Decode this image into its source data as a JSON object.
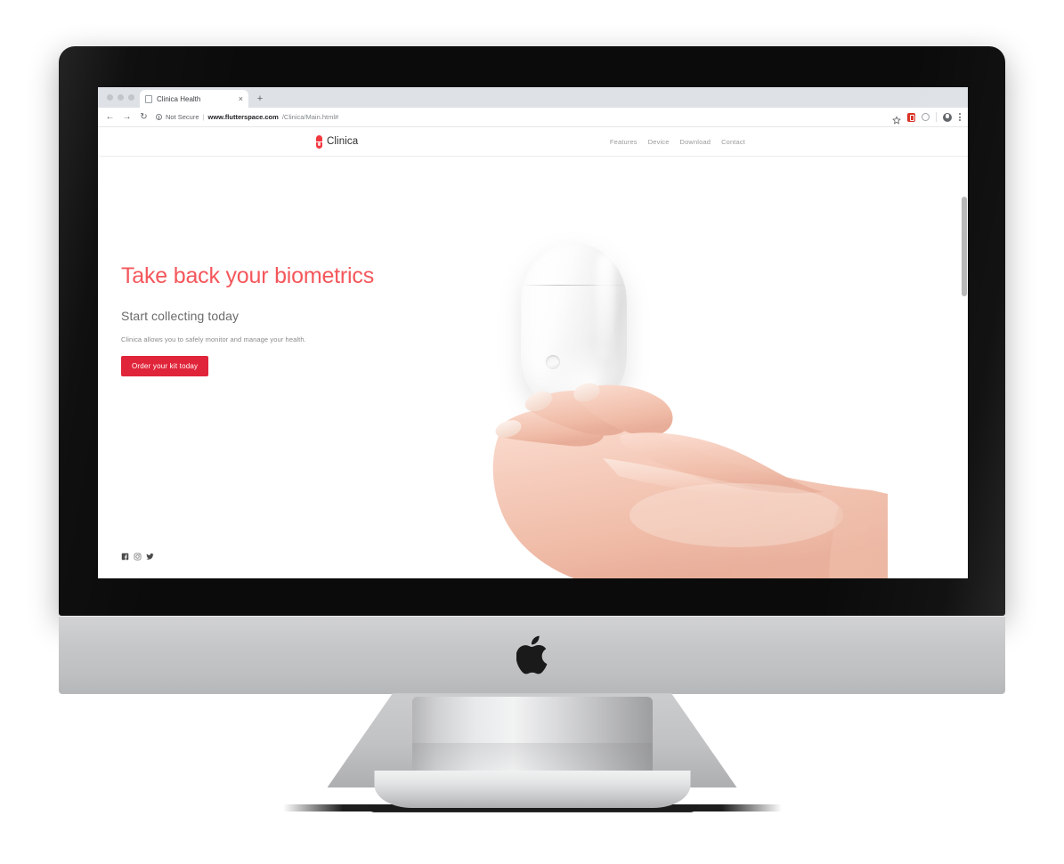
{
  "browser": {
    "traffic_lights": [
      "close",
      "minimize",
      "maximize"
    ],
    "tab": {
      "title": "Clinica Health",
      "close_label": "×",
      "favicon": "page-icon"
    },
    "new_tab_label": "+",
    "nav": {
      "back": "←",
      "forward": "→",
      "reload": "↻"
    },
    "omnibox": {
      "security_label": "Not Secure",
      "separator": "|",
      "url_domain": "www.flutterspace.com",
      "url_path": "/Clinica/Main.html#",
      "full_url": "www.flutterspace.com/Clinica/Main.html#"
    },
    "toolbar_icons": [
      {
        "name": "bookmark-star-icon",
        "glyph": "☆"
      },
      {
        "name": "extension-badge-icon",
        "color": "#d93025"
      },
      {
        "name": "extension-circle-icon"
      },
      {
        "name": "profile-avatar-icon"
      },
      {
        "name": "chrome-menu-icon"
      }
    ]
  },
  "site": {
    "brand": {
      "logo_icon": "pill-capsule-icon",
      "name": "Clinica"
    },
    "nav_items": [
      {
        "label": "Features"
      },
      {
        "label": "Device"
      },
      {
        "label": "Download"
      },
      {
        "label": "Contact"
      }
    ],
    "hero": {
      "headline": "Take back your biometrics",
      "subhead": "Start collecting today",
      "blurb": "Clinica allows you to safely monitor and manage your health.",
      "cta_label": "Order your kit today",
      "art_description": "white pill-shaped biometric device floating above an open palm"
    },
    "social": [
      {
        "name": "facebook-icon",
        "glyph": "f"
      },
      {
        "name": "instagram-icon",
        "glyph": "◎"
      },
      {
        "name": "twitter-icon",
        "glyph": "✒"
      }
    ]
  },
  "hardware": {
    "device_name": "iMac",
    "logo": "apple-logo",
    "webcam": "facetime-camera",
    "status_led": "green"
  },
  "colors": {
    "headline_coral": "#f4575b",
    "cta_red": "#e0253a",
    "brand_red": "#f2383f",
    "subhead_gray": "#6b6b6b",
    "body_gray": "#8a8a8a",
    "nav_gray": "#9a9a9a",
    "bezel_black": "#0b0b0b",
    "aluminum": "#c6c7c9",
    "tabstrip_gray": "#dee1e6"
  }
}
